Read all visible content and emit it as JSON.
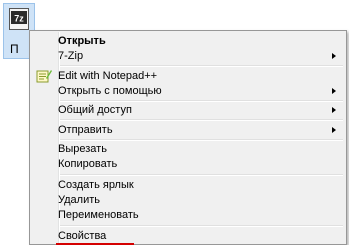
{
  "desktop_file": {
    "icon": "7zip-archive-icon",
    "icon_text": "7z",
    "name": "П"
  },
  "context_menu": {
    "items": [
      {
        "label": "Открыть",
        "bold": true
      },
      {
        "label": "7-Zip",
        "submenu": true
      },
      {
        "label": "Edit with Notepad++",
        "icon": "notepad-plus-plus-icon"
      },
      {
        "label": "Открыть с помощью",
        "submenu": true
      },
      {
        "label": "Общий доступ",
        "submenu": true
      },
      {
        "label": "Отправить",
        "submenu": true
      },
      {
        "label": "Вырезать"
      },
      {
        "label": "Копировать"
      },
      {
        "label": "Создать ярлык"
      },
      {
        "label": "Удалить"
      },
      {
        "label": "Переименовать"
      },
      {
        "label": "Свойства",
        "highlighted_underline": true
      }
    ]
  },
  "colors": {
    "menu_background": "#f0f0f0",
    "menu_border": "#979797",
    "underline": "#d40000"
  }
}
